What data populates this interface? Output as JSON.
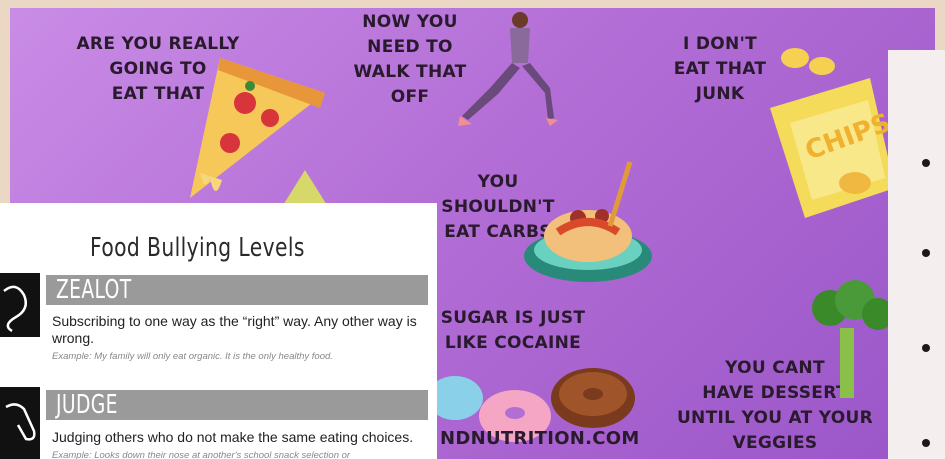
{
  "phrases": {
    "pizza": [
      "ARE YOU REALLY",
      "GOING TO",
      "EAT THAT"
    ],
    "walk": [
      "NOW YOU",
      "NEED TO",
      "WALK THAT",
      "OFF"
    ],
    "junk": [
      "I DON'T",
      "EAT THAT",
      "JUNK"
    ],
    "carbs": [
      "YOU SHOULDN'T",
      "EAT CARBS"
    ],
    "sugar": [
      "SUGAR IS JUST",
      "LIKE COCAINE"
    ],
    "dessert": [
      "YOU CANT",
      "HAVE DESSERT",
      "UNTIL YOU AT YOUR",
      "VEGGIES"
    ]
  },
  "chips_label": "CHIPS",
  "website": "NDNUTRITION.COM",
  "card": {
    "title": "Food Bullying Levels",
    "levels": [
      {
        "name": "ZEALOT",
        "description": "Subscribing to one way as the “right” way. Any other way is wrong.",
        "example": "Example: My family will only eat organic.  It is the only healthy food."
      },
      {
        "name": "JUDGE",
        "description": "Judging others who do not make the same eating choices.",
        "example": "Example: Looks down their nose at another's school snack selection or"
      }
    ]
  },
  "colors": {
    "background": "#ead8c4",
    "purple": "#b36ed6",
    "bar_gray": "#9a9a9a",
    "text_dark": "#2a1a2e"
  }
}
